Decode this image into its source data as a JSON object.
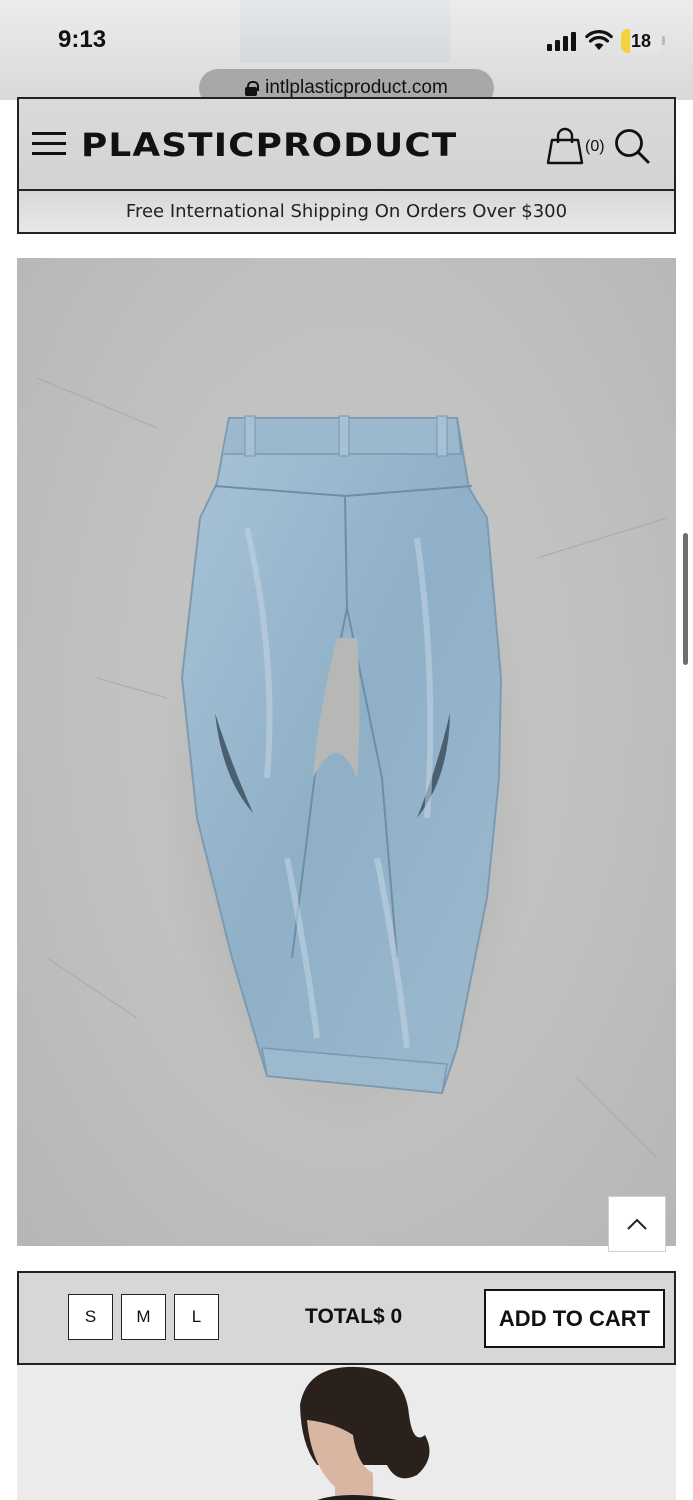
{
  "status_bar": {
    "time": "9:13",
    "battery_level": "18",
    "icons": [
      "signal-icon",
      "wifi-icon",
      "battery-icon"
    ]
  },
  "browser": {
    "url": "intlplasticproduct.com",
    "icons": [
      "lock-icon"
    ]
  },
  "header": {
    "logo": "PLASTICPRODUCT",
    "cart_count": "(0)",
    "promo": "Free International Shipping On Orders Over $300",
    "icons": [
      "hamburger-menu-icon",
      "shopping-bag-icon",
      "search-icon"
    ]
  },
  "product": {
    "image_subject": "light-wash denim jeans, back view",
    "icons": [
      "chevron-up-icon"
    ]
  },
  "purchase": {
    "sizes": [
      "S",
      "M",
      "L"
    ],
    "total": "TOTAL$ 0",
    "add_to_cart": "ADD TO CART"
  },
  "colors": {
    "header_bg": "#d6d6d6",
    "border": "#222222",
    "photo_bg": "#c4c4c3",
    "denim": "#8fb0c8"
  }
}
